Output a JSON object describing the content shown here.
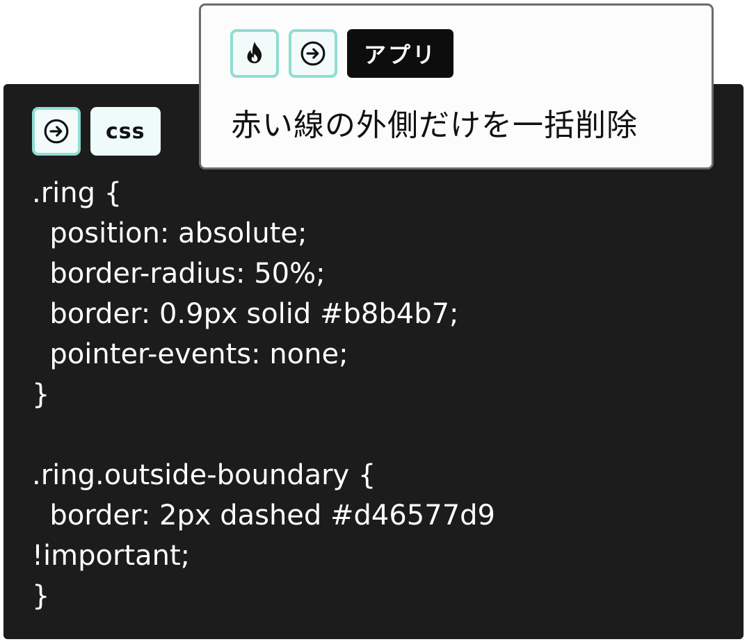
{
  "code_block": {
    "language": "css",
    "lines": [
      ".ring {",
      "  position: absolute;",
      "  border-radius: 50%;",
      "  border: 0.9px solid #b8b4b7;",
      "  pointer-events: none;",
      "}",
      "",
      ".ring.outside-boundary {",
      "  border: 2px dashed #d46577d9",
      "!important;",
      "}"
    ],
    "icons": {
      "jump": "arrow-right-circle-icon"
    }
  },
  "popup": {
    "badge_label": "アプリ",
    "message": "赤い線の外側だけを一括削除",
    "icons": {
      "hot": "flame-icon",
      "jump": "arrow-right-circle-icon"
    }
  },
  "colors": {
    "accent_border": "#8fddd2",
    "code_bg": "#1c1c1c",
    "popup_border": "#6b6b6b",
    "badge_bg": "#0d0d0d"
  }
}
